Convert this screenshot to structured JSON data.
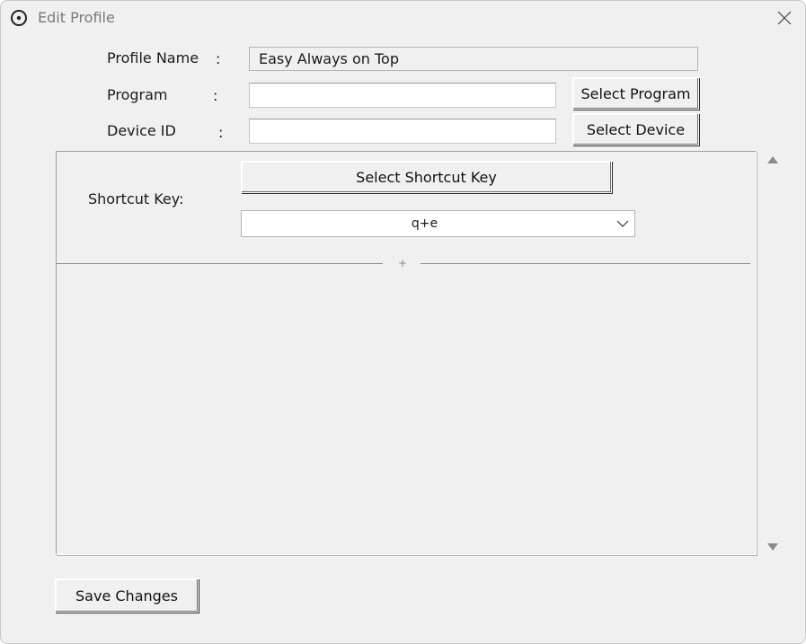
{
  "window": {
    "title": "Edit Profile"
  },
  "form": {
    "profile_name": {
      "label": "Profile Name",
      "colon": ":",
      "value": "Easy Always on Top"
    },
    "program": {
      "label": "Program",
      "colon": ":",
      "value": ""
    },
    "device_id": {
      "label": "Device ID",
      "colon": ":",
      "value": ""
    },
    "select_program_label": "Select Program",
    "select_device_label": "Select Device"
  },
  "shortcut": {
    "label": "Shortcut Key:",
    "select_button_label": "Select Shortcut Key",
    "selected_value": "q+e",
    "sash_grip": "+"
  },
  "footer": {
    "save_label": "Save Changes"
  },
  "icons": {
    "app": "app-icon",
    "close": "close-icon",
    "dropdown": "chevron-down-icon",
    "scroll_up": "triangle-up-icon",
    "scroll_down": "triangle-down-icon"
  },
  "colors": {
    "window_bg": "#f0f0f0",
    "field_bg": "#ffffff",
    "title_text": "#7a7a7a"
  }
}
